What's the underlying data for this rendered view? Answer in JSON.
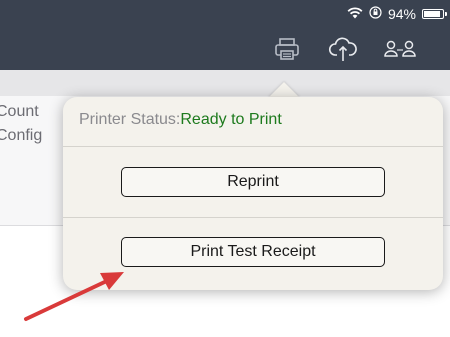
{
  "status_bar": {
    "battery_text": "94%",
    "battery_level": 0.94
  },
  "toolbar": {
    "icons": [
      "printer-icon",
      "cloud-upload-icon",
      "users-icon"
    ]
  },
  "background": {
    "left_text_line1": "Count",
    "left_text_line2": "Config"
  },
  "popover": {
    "status_label": "Printer Status:",
    "status_value": "Ready to Print",
    "reprint_label": "Reprint",
    "print_test_label": "Print Test Receipt"
  },
  "colors": {
    "toolbar_bg": "#3a4250",
    "status_ok": "#1d7a1d",
    "annotation_arrow": "#d93a3a"
  }
}
